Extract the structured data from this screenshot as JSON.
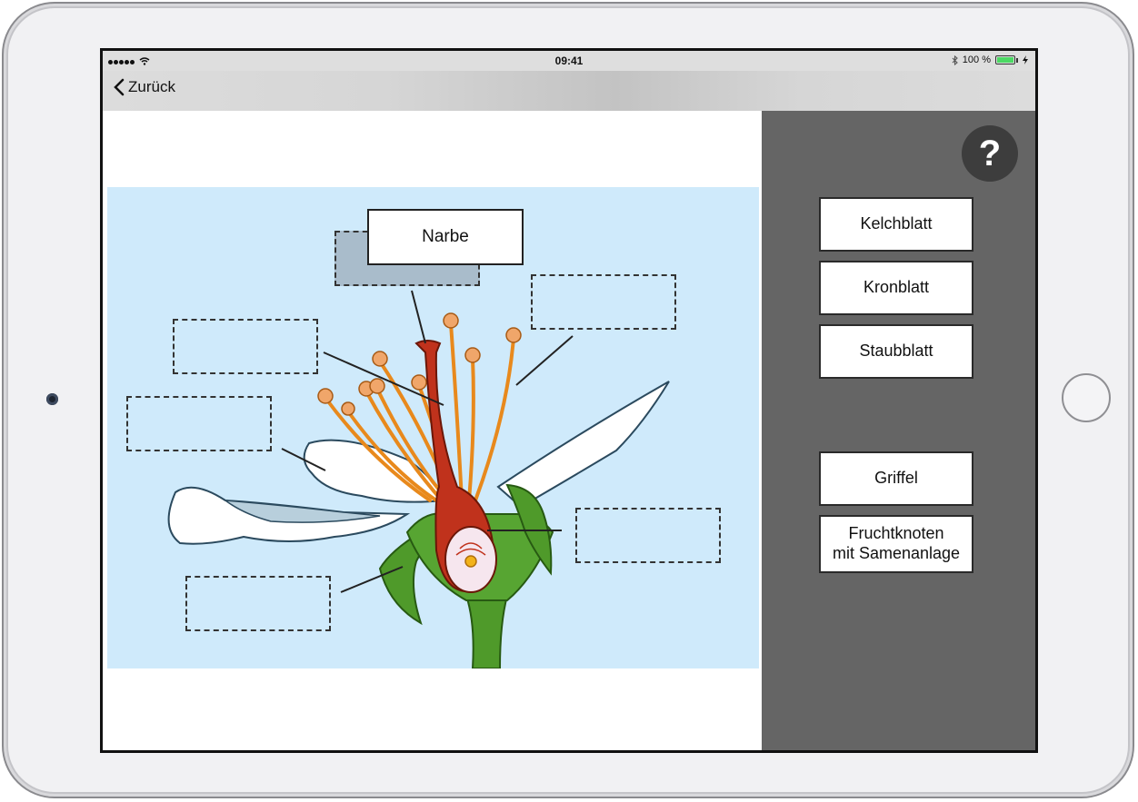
{
  "status_bar": {
    "time": "09:41",
    "battery_percent": "100 %"
  },
  "nav": {
    "back_label": "Zurück"
  },
  "diagram": {
    "placed_label": "Narbe",
    "drop_zones": [
      "zone-1",
      "zone-2",
      "zone-3",
      "zone-4",
      "zone-5",
      "zone-6"
    ]
  },
  "side_panel": {
    "help_label": "?",
    "tiles": [
      {
        "label": "Kelchblatt"
      },
      {
        "label": "Kronblatt"
      },
      {
        "label": "Staubblatt"
      },
      {
        "label": "Griffel"
      },
      {
        "label": "Fruchtknoten\nmit Samenanlage"
      }
    ]
  },
  "colors": {
    "diagram_background": "#cfeafb",
    "panel_background": "#656565",
    "pistil": "#c0321c",
    "stamen": "#e8891c",
    "sepal": "#4f9a2a",
    "petal": "#ffffff"
  }
}
